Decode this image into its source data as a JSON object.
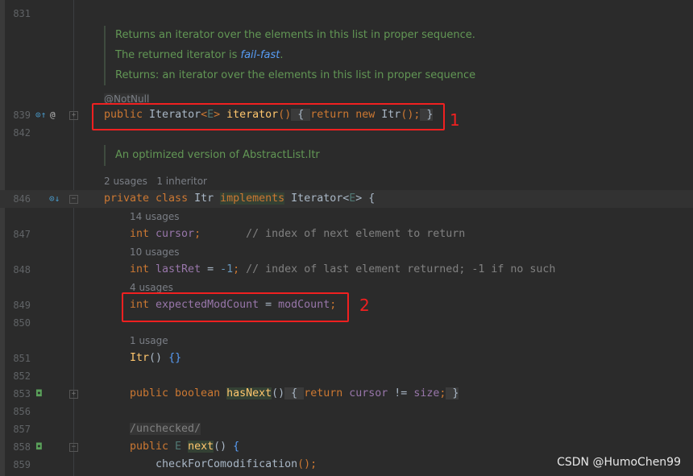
{
  "editor": {
    "rows": [
      {
        "kind": "code",
        "line": "831",
        "tokens": []
      },
      {
        "kind": "doc",
        "text": "Returns an iterator over the elements in this list in proper sequence."
      },
      {
        "kind": "doc",
        "text": "The returned iterator is ",
        "link": "fail-fast",
        "after": "."
      },
      {
        "kind": "doc",
        "text": "Returns: an iterator over the elements in this list in proper sequence"
      },
      {
        "kind": "annotation",
        "text": "@NotNull"
      },
      {
        "kind": "code",
        "line": "839",
        "icons": [
          "override-up-icon",
          "at-icon"
        ],
        "fold": "plus",
        "tokens": [
          [
            "public ",
            "kw"
          ],
          [
            "Iterator",
            "type"
          ],
          [
            "<",
            "kw"
          ],
          [
            "E",
            "gen"
          ],
          [
            "> ",
            "kw"
          ],
          [
            "iterator",
            "method"
          ],
          [
            "()",
            "kw"
          ],
          [
            " { ",
            "brace"
          ],
          [
            "return new ",
            "kw"
          ],
          [
            "Itr",
            "type"
          ],
          [
            "();",
            "kw"
          ],
          [
            " }",
            "brace"
          ]
        ]
      },
      {
        "kind": "code",
        "line": "842",
        "tokens": []
      },
      {
        "kind": "doc",
        "text": "An optimized version of AbstractList.Itr"
      },
      {
        "kind": "hint",
        "text": "2 usages   1 inheritor"
      },
      {
        "kind": "code",
        "line": "846",
        "current": true,
        "icons": [
          "implemented-down-icon"
        ],
        "fold": "minus",
        "tokens": [
          [
            "private class ",
            "kw"
          ],
          [
            "Itr ",
            "type"
          ],
          [
            "implements",
            "kwhl"
          ],
          [
            " Iterator",
            "type"
          ],
          [
            "<",
            "plain"
          ],
          [
            "E",
            "gen"
          ],
          [
            "> {",
            "plain"
          ]
        ]
      },
      {
        "kind": "hint",
        "indent": 1,
        "text": "14 usages"
      },
      {
        "kind": "code",
        "line": "847",
        "indent": 1,
        "tokens": [
          [
            "int ",
            "kw"
          ],
          [
            "cursor",
            "field"
          ],
          [
            ";",
            "kw"
          ],
          [
            "       // index of next element to return",
            "comment"
          ]
        ]
      },
      {
        "kind": "hint",
        "indent": 1,
        "text": "10 usages"
      },
      {
        "kind": "code",
        "line": "848",
        "indent": 1,
        "tokens": [
          [
            "int ",
            "kw"
          ],
          [
            "lastRet",
            "field"
          ],
          [
            " = ",
            "plain"
          ],
          [
            "-1",
            "num"
          ],
          [
            "; ",
            "kw"
          ],
          [
            "// index of last element returned; -1 if no such",
            "comment"
          ]
        ]
      },
      {
        "kind": "hint",
        "indent": 1,
        "text": "4 usages"
      },
      {
        "kind": "code",
        "line": "849",
        "indent": 1,
        "tokens": [
          [
            "int ",
            "kw"
          ],
          [
            "expectedModCount",
            "field"
          ],
          [
            " = ",
            "plain"
          ],
          [
            "modCount",
            "field"
          ],
          [
            ";",
            "kw"
          ]
        ]
      },
      {
        "kind": "code",
        "line": "850",
        "tokens": []
      },
      {
        "kind": "hint",
        "indent": 1,
        "text": "1 usage"
      },
      {
        "kind": "code",
        "line": "851",
        "indent": 1,
        "tokens": [
          [
            "Itr",
            "method"
          ],
          [
            "() ",
            "plain"
          ],
          [
            "{}",
            "blue"
          ]
        ]
      },
      {
        "kind": "code",
        "line": "852",
        "tokens": []
      },
      {
        "kind": "code",
        "line": "853",
        "indent": 1,
        "icons": [
          "implements-method-icon"
        ],
        "fold": "plus",
        "tokens": [
          [
            "public boolean ",
            "kw"
          ],
          [
            "hasNext",
            "mhl"
          ],
          [
            "()",
            "plain"
          ],
          [
            " { ",
            "brace"
          ],
          [
            "return ",
            "kw"
          ],
          [
            "cursor",
            "field"
          ],
          [
            " != ",
            "plain"
          ],
          [
            "size",
            "field"
          ],
          [
            ";",
            "kw"
          ],
          [
            " }",
            "brace"
          ]
        ]
      },
      {
        "kind": "code",
        "line": "856",
        "tokens": []
      },
      {
        "kind": "code",
        "line": "857",
        "indent": 1,
        "tokens": [
          [
            "/unchecked/",
            "anno"
          ]
        ]
      },
      {
        "kind": "code",
        "line": "858",
        "indent": 1,
        "icons": [
          "implements-method-icon"
        ],
        "fold": "minus",
        "tokens": [
          [
            "public ",
            "kw"
          ],
          [
            "E ",
            "gen"
          ],
          [
            "next",
            "mhl"
          ],
          [
            "() ",
            "plain"
          ],
          [
            "{",
            "blue"
          ]
        ]
      },
      {
        "kind": "code",
        "line": "859",
        "indent": 2,
        "tokens": [
          [
            "checkForComodification",
            "plain"
          ],
          [
            "();",
            "kw"
          ]
        ]
      }
    ]
  },
  "annotations": {
    "marker1": "1",
    "marker2": "2",
    "box_color": "#f02020"
  },
  "watermark": "CSDN @HumoChen99",
  "colors": {
    "background": "#2b2b2b",
    "keyword": "#cc7832",
    "field": "#9876aa",
    "method": "#ffc66d",
    "comment": "#808080",
    "javadoc": "#629755",
    "line_number": "#606366"
  }
}
